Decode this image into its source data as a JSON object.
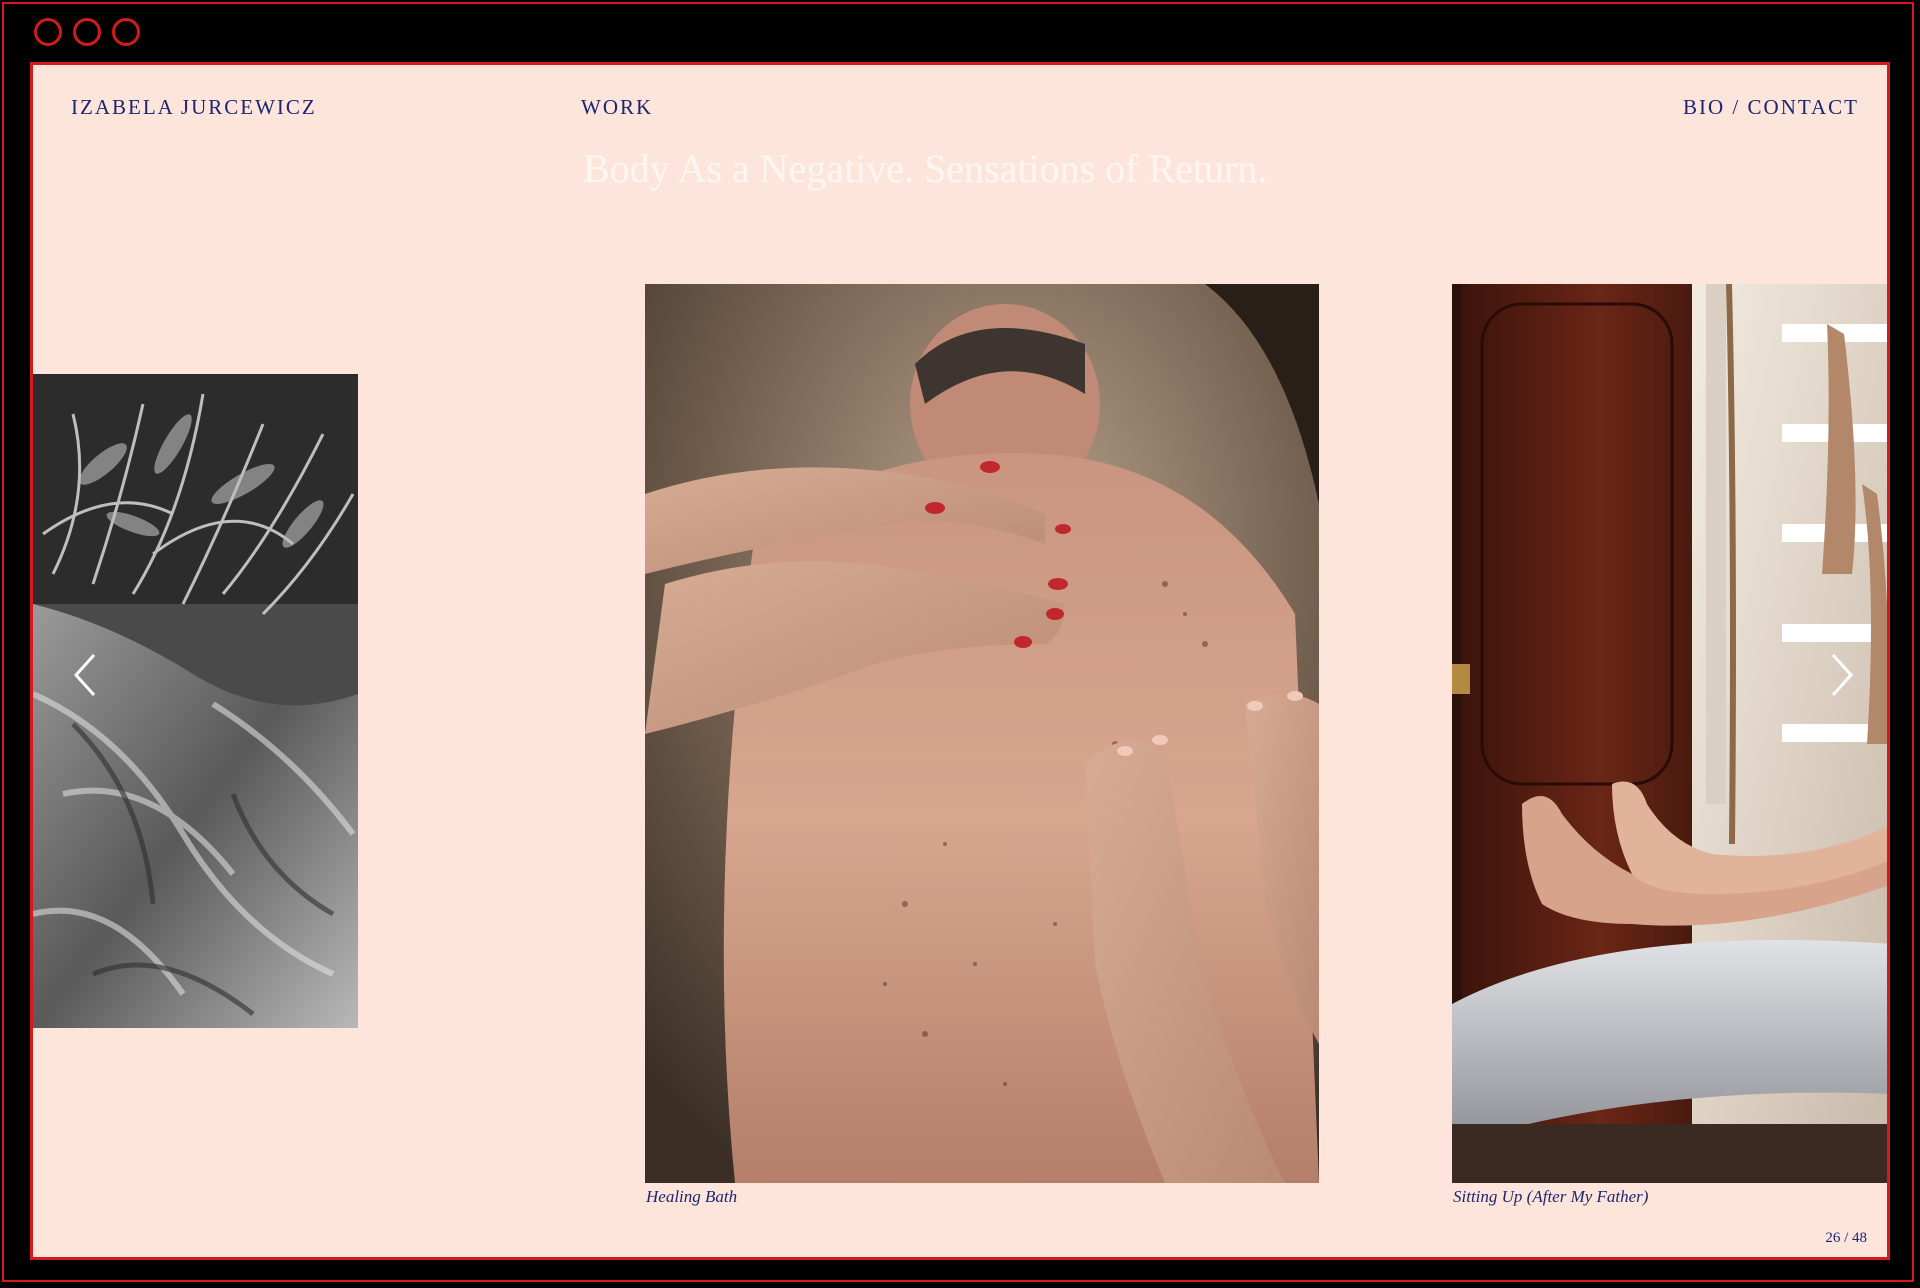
{
  "window": {
    "controls": [
      "close",
      "minimize",
      "maximize"
    ],
    "accent_color": "#d41a1a"
  },
  "header": {
    "site_name": "IZABELA JURCEWICZ",
    "work_label": "WORK",
    "bio_contact_label": "BIO / CONTACT"
  },
  "project": {
    "title": "Body As a Negative. Sensations of Return."
  },
  "gallery": {
    "center_caption": "Healing Bath",
    "right_caption": "Sitting Up (After My Father)",
    "counter": "26 / 48",
    "prev_icon": "chevron-left-icon",
    "next_icon": "chevron-right-icon"
  },
  "colors": {
    "background": "#fde5dc",
    "text": "#1c2670",
    "title": "#fff6f2"
  }
}
